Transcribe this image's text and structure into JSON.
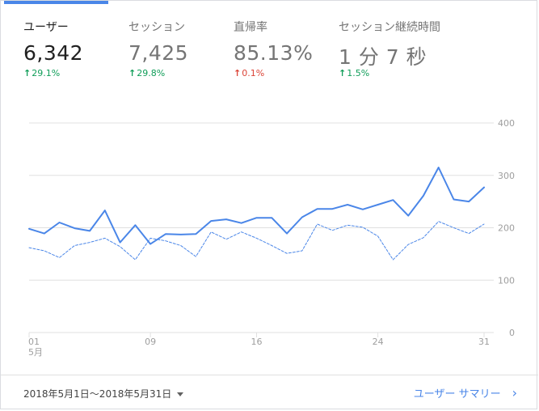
{
  "metrics": [
    {
      "label": "ユーザー",
      "value": "6,342",
      "delta_arrow": "↑",
      "delta": "29.1%",
      "trend": "up",
      "active": true
    },
    {
      "label": "セッション",
      "value": "7,425",
      "delta_arrow": "↑",
      "delta": "29.8%",
      "trend": "up",
      "active": false
    },
    {
      "label": "直帰率",
      "value": "85.13%",
      "delta_arrow": "↑",
      "delta": "0.1%",
      "trend": "down",
      "active": false
    },
    {
      "label": "セッション継続時間",
      "value": "1 分 7 秒",
      "delta_arrow": "↑",
      "delta": "1.5%",
      "trend": "up",
      "active": false
    }
  ],
  "colors": {
    "accent": "#4a86e8",
    "up": "#0f9d58",
    "down": "#db4437",
    "grid": "#e0e0e0",
    "axis_text": "#9e9e9e"
  },
  "chart_data": {
    "type": "line",
    "x": [
      1,
      2,
      3,
      4,
      5,
      6,
      7,
      8,
      9,
      10,
      11,
      12,
      13,
      14,
      15,
      16,
      17,
      18,
      19,
      20,
      21,
      22,
      23,
      24,
      25,
      26,
      27,
      28,
      29,
      30,
      31
    ],
    "x_tick_values": [
      1,
      9,
      16,
      24,
      31
    ],
    "x_tick_labels": [
      "01",
      "09",
      "16",
      "24",
      "31"
    ],
    "x_sublabel": "5月",
    "ylim": [
      0,
      400
    ],
    "y_ticks": [
      0,
      100,
      200,
      300,
      400
    ],
    "y_tick_labels": [
      "0",
      "100",
      "200",
      "300",
      "400"
    ],
    "grid": true,
    "series": [
      {
        "style": "solid",
        "values": [
          198,
          189,
          210,
          199,
          194,
          233,
          172,
          205,
          169,
          188,
          187,
          188,
          213,
          216,
          209,
          219,
          219,
          189,
          220,
          236,
          236,
          244,
          235,
          244,
          253,
          223,
          261,
          315,
          254,
          250,
          277
        ]
      },
      {
        "style": "dashed",
        "values": [
          162,
          156,
          143,
          166,
          172,
          180,
          164,
          139,
          180,
          175,
          166,
          145,
          192,
          178,
          192,
          180,
          166,
          151,
          156,
          207,
          195,
          205,
          201,
          184,
          139,
          168,
          181,
          212,
          200,
          189,
          207
        ]
      }
    ]
  },
  "footer": {
    "date_range": "2018年5月1日～2018年5月31日",
    "summary_link": "ユーザー サマリー",
    "chevron": "›"
  }
}
